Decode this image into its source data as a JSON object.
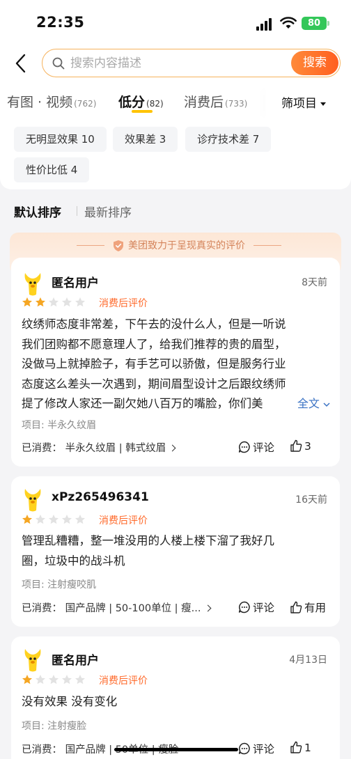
{
  "status": {
    "time": "22:35",
    "battery": "80"
  },
  "search": {
    "placeholder": "搜索内容描述",
    "button": "搜索"
  },
  "tabs": [
    {
      "label": "有图 · 视频",
      "count": "(762)"
    },
    {
      "label": "低分",
      "count": "(82)",
      "active": true
    },
    {
      "label": "消费后",
      "count": "(733)"
    }
  ],
  "filter_label": "筛项目",
  "chips": [
    "无明显效果 10",
    "效果差 3",
    "诊疗技术差 7",
    "性价比低 4"
  ],
  "sort": {
    "default": "默认排序",
    "latest": "最新排序"
  },
  "banner": "美团致力于呈现真实的评价",
  "colors": {
    "accent": "#ff6a2b",
    "star": "#f5a623",
    "link": "#3a72c4"
  },
  "reviews": [
    {
      "user": "匿名用户",
      "date": "8天前",
      "stars": 2,
      "tag": "消费后评价",
      "text_lines": [
        "纹绣师态度非常差，下午去的没什么人，但是一听说",
        "我们团购都不愿意理人了，给我们推荐的贵的眉型，",
        "没做马上就掉脸子，有手艺可以骄傲，但是服务行业",
        "态度这么差头一次遇到，期间眉型设计之后跟纹绣师",
        "提了修改人家还一副欠她八百万的嘴脸，你们美"
      ],
      "more": "全文",
      "project": "项目: 半永久纹眉",
      "consumed": "已消费： 半永久纹眉 | 韩式纹眉",
      "comment": "评论",
      "likes": "3"
    },
    {
      "user": "xPz265496341",
      "date": "16天前",
      "stars": 1,
      "tag": "消费后评价",
      "text_lines": [
        "管理乱糟糟，整一堆没用的人楼上楼下溜了我好几",
        "圈，垃圾中的战斗机"
      ],
      "project": "项目: 注射瘦咬肌",
      "consumed": "已消费： 国产品牌 | 50-100单位 | 瘦...",
      "comment": "评论",
      "likes": "有用"
    },
    {
      "user": "匿名用户",
      "date": "4月13日",
      "stars": 1,
      "tag": "消费后评价",
      "text_lines": [
        "没有效果 没有变化"
      ],
      "project": "项目: 注射瘦脸",
      "consumed": "已消费： 国产品牌 | 50单位 | 瘦脸",
      "comment": "评论",
      "likes": "1"
    }
  ]
}
